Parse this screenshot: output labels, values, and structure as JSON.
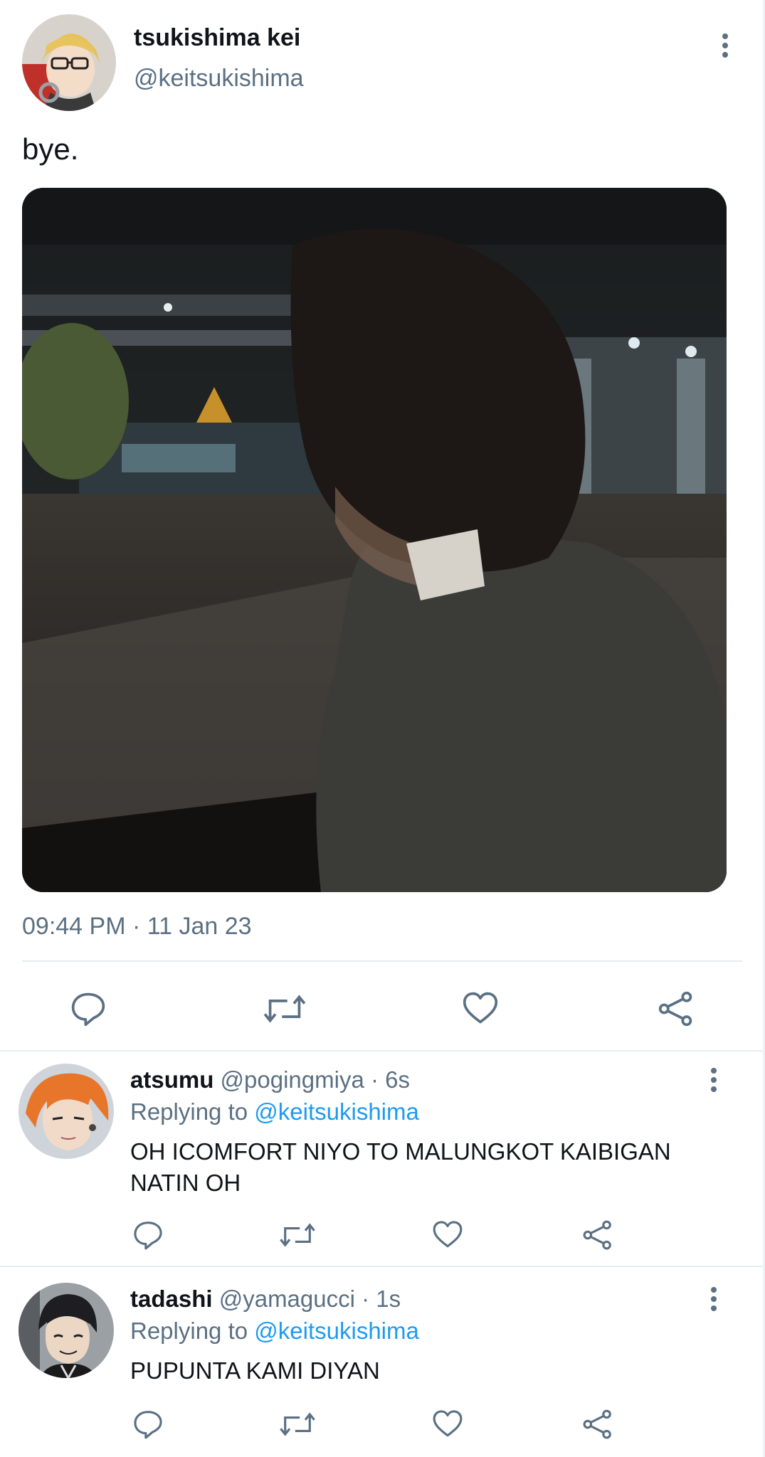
{
  "main_tweet": {
    "display_name": "tsukishima kei",
    "handle": "@keitsukishima",
    "text": "bye.",
    "timestamp": "09:44 PM · 11 Jan 23",
    "avatar_icon": "anime-avatar-blond-glasses",
    "photo_icon": "night-street-photo"
  },
  "replies": [
    {
      "display_name": "atsumu",
      "handle": "@pogingmiya",
      "separator": "·",
      "time": "6s",
      "replying_prefix": "Replying to",
      "replying_handle": "@keitsukishima",
      "text": "OH ICOMFORT NIYO TO MALUNGKOT KAIBIGAN NATIN OH",
      "avatar_icon": "anime-avatar-orange-hair"
    },
    {
      "display_name": "tadashi",
      "handle": "@yamagucci",
      "separator": "·",
      "time": "1s",
      "replying_prefix": "Replying to",
      "replying_handle": "@keitsukishima",
      "text": "PUPUNTA KAMI DIYAN",
      "avatar_icon": "anime-avatar-dark-hair"
    }
  ],
  "colors": {
    "text": "#0f1419",
    "secondary": "#5b7083",
    "link": "#1d9bf0",
    "divider": "#e6ecf0"
  }
}
